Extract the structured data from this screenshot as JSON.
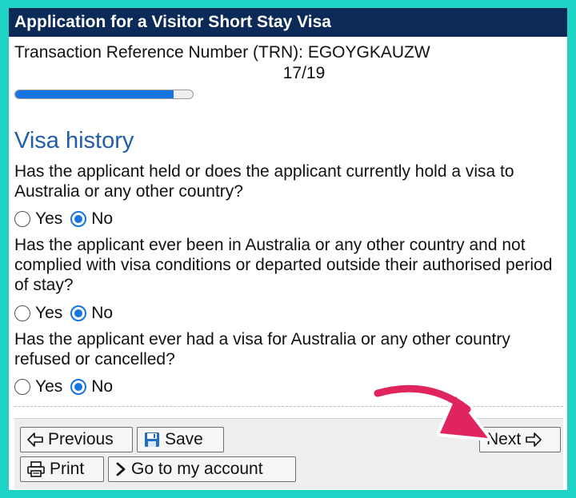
{
  "header": {
    "title": "Application for a Visitor Short Stay Visa"
  },
  "transaction": {
    "reference": "Transaction Reference Number (TRN): EGOYGKAUZW",
    "step": "17/19"
  },
  "progress": {
    "fraction": 0.89
  },
  "section": {
    "heading": "Visa history"
  },
  "questions": [
    {
      "text": "Has the applicant held or does the applicant currently hold a visa to Australia or any other country?",
      "yes_label": "Yes",
      "no_label": "No",
      "selected": "No"
    },
    {
      "text": "Has the applicant ever been in Australia or any other country and not complied with visa conditions or departed outside their authorised period of stay?",
      "yes_label": "Yes",
      "no_label": "No",
      "selected": "No"
    },
    {
      "text": "Has the applicant ever had a visa for Australia or any other country refused or cancelled?",
      "yes_label": "Yes",
      "no_label": "No",
      "selected": "No"
    }
  ],
  "footer": {
    "previous_label": "Previous",
    "save_label": "Save",
    "next_label": "Next",
    "print_label": "Print",
    "account_label": "Go to my account"
  },
  "colors": {
    "title_bg": "#0b2a57",
    "accent": "#1675e0",
    "heading": "#1f5fa8",
    "frame": "#1fd3c6",
    "annotation_arrow": "#e0245e"
  }
}
